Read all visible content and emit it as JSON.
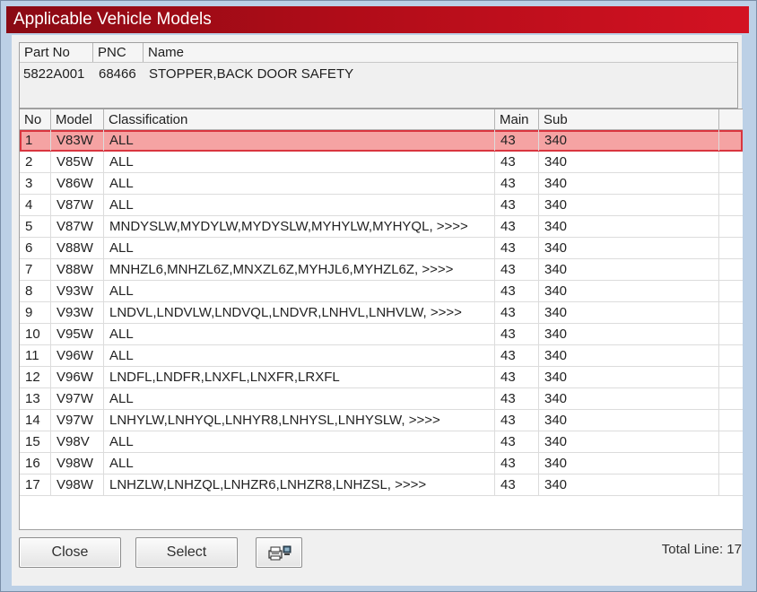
{
  "window": {
    "title": "Applicable Vehicle Models"
  },
  "part": {
    "headers": {
      "part_no": "Part No",
      "pnc": "PNC",
      "name": "Name"
    },
    "values": {
      "part_no": "5822A001",
      "pnc": "68466",
      "name": "STOPPER,BACK DOOR SAFETY"
    }
  },
  "table": {
    "headers": {
      "no": "No",
      "model": "Model",
      "classification": "Classification",
      "main": "Main",
      "sub": "Sub"
    },
    "rows": [
      {
        "no": "1",
        "model": "V83W",
        "classification": "ALL",
        "main": "43",
        "sub": "340"
      },
      {
        "no": "2",
        "model": "V85W",
        "classification": "ALL",
        "main": "43",
        "sub": "340"
      },
      {
        "no": "3",
        "model": "V86W",
        "classification": "ALL",
        "main": "43",
        "sub": "340"
      },
      {
        "no": "4",
        "model": "V87W",
        "classification": "ALL",
        "main": "43",
        "sub": "340"
      },
      {
        "no": "5",
        "model": "V87W",
        "classification": "MNDYSLW,MYDYLW,MYDYSLW,MYHYLW,MYHYQL,  >>>>",
        "main": "43",
        "sub": "340"
      },
      {
        "no": "6",
        "model": "V88W",
        "classification": "ALL",
        "main": "43",
        "sub": "340"
      },
      {
        "no": "7",
        "model": "V88W",
        "classification": "MNHZL6,MNHZL6Z,MNXZL6Z,MYHJL6,MYHZL6Z,  >>>>",
        "main": "43",
        "sub": "340"
      },
      {
        "no": "8",
        "model": "V93W",
        "classification": "ALL",
        "main": "43",
        "sub": "340"
      },
      {
        "no": "9",
        "model": "V93W",
        "classification": "LNDVL,LNDVLW,LNDVQL,LNDVR,LNHVL,LNHVLW,  >>>>",
        "main": "43",
        "sub": "340"
      },
      {
        "no": "10",
        "model": "V95W",
        "classification": "ALL",
        "main": "43",
        "sub": "340"
      },
      {
        "no": "11",
        "model": "V96W",
        "classification": "ALL",
        "main": "43",
        "sub": "340"
      },
      {
        "no": "12",
        "model": "V96W",
        "classification": "LNDFL,LNDFR,LNXFL,LNXFR,LRXFL",
        "main": "43",
        "sub": "340"
      },
      {
        "no": "13",
        "model": "V97W",
        "classification": "ALL",
        "main": "43",
        "sub": "340"
      },
      {
        "no": "14",
        "model": "V97W",
        "classification": "LNHYLW,LNHYQL,LNHYR8,LNHYSL,LNHYSLW,  >>>>",
        "main": "43",
        "sub": "340"
      },
      {
        "no": "15",
        "model": "V98V",
        "classification": "ALL",
        "main": "43",
        "sub": "340"
      },
      {
        "no": "16",
        "model": "V98W",
        "classification": "ALL",
        "main": "43",
        "sub": "340"
      },
      {
        "no": "17",
        "model": "V98W",
        "classification": "LNHZLW,LNHZQL,LNHZR6,LNHZR8,LNHZSL,  >>>>",
        "main": "43",
        "sub": "340"
      }
    ],
    "selected_index": 0
  },
  "buttons": {
    "close_label": "Close",
    "select_label": "Select",
    "print_icon": "printer-icon"
  },
  "footer": {
    "total_line": "Total Line: 17"
  },
  "colors": {
    "title_bar": "#b00c18",
    "selected_row": "#f5a3a3",
    "selected_outline": "#d9353f"
  }
}
